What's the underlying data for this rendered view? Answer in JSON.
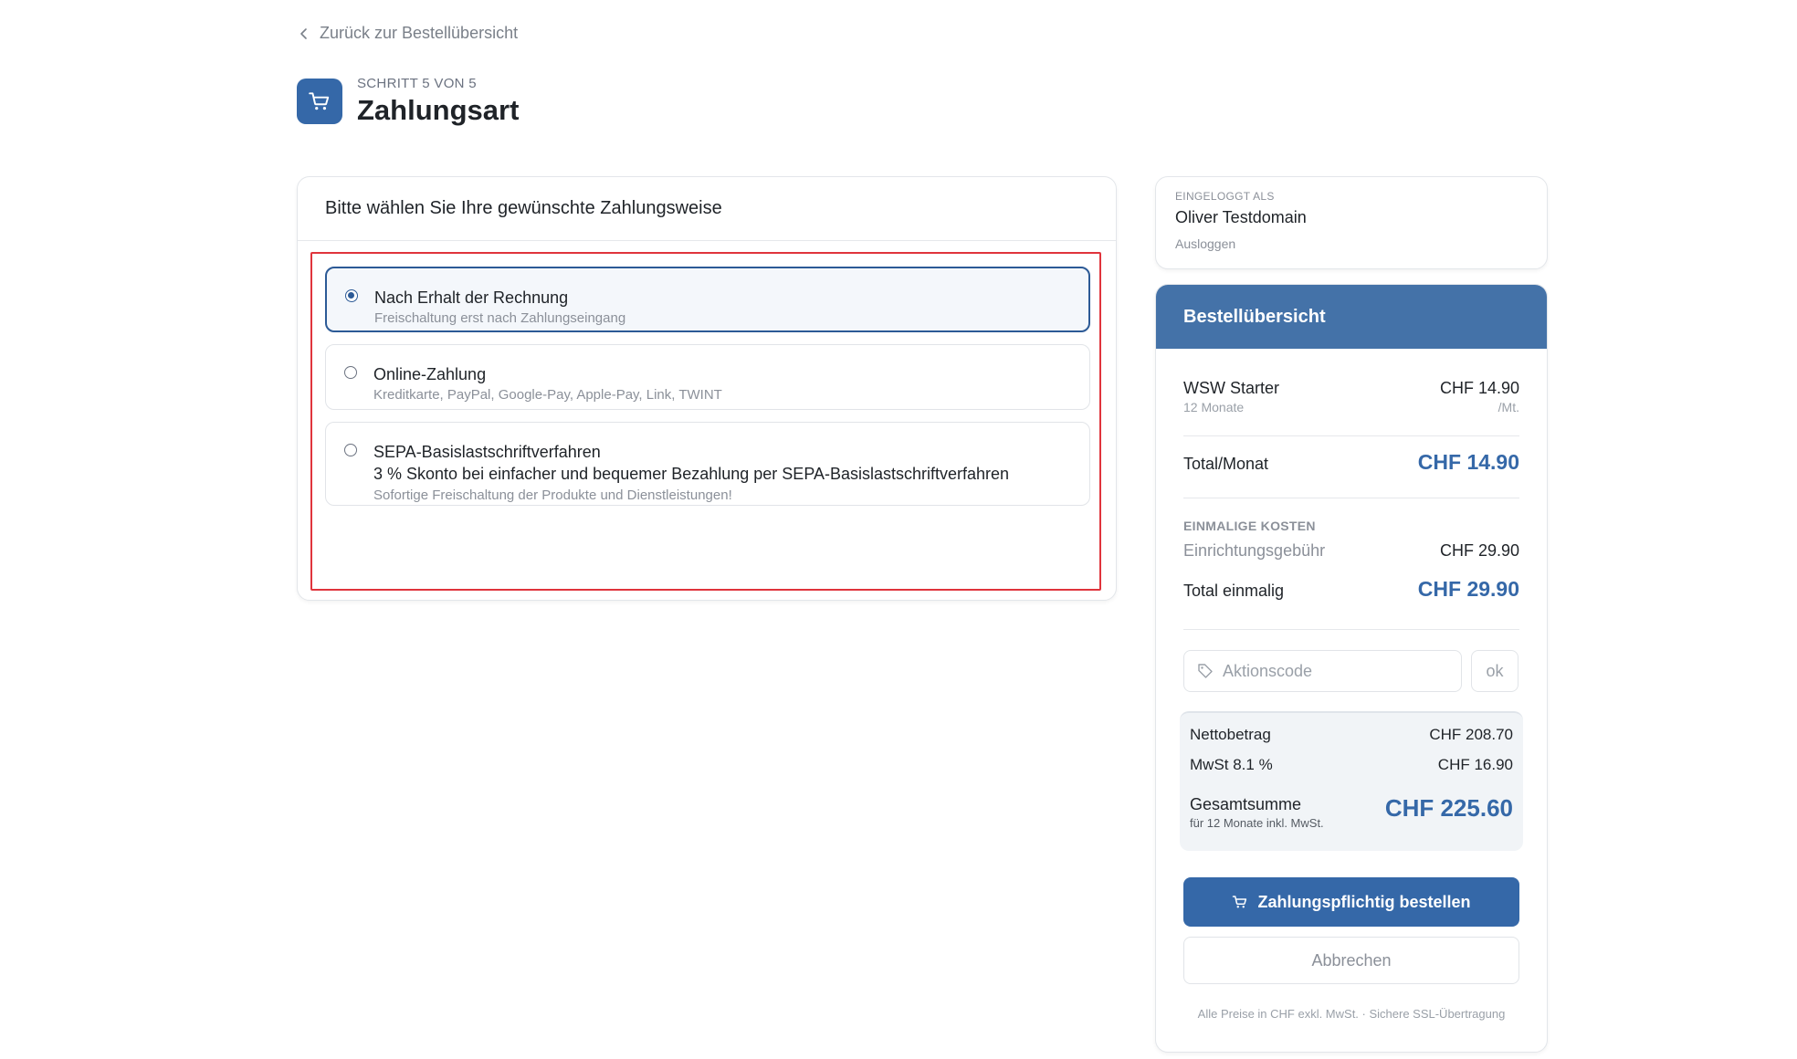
{
  "nav": {
    "back_label": "Zurück zur Bestellübersicht"
  },
  "header": {
    "step": "SCHRITT 5 VON 5",
    "title": "Zahlungsart"
  },
  "payment": {
    "heading": "Bitte wählen Sie Ihre gewünschte Zahlungsweise",
    "options": [
      {
        "title": "Nach Erhalt der Rechnung",
        "subtitle": "Freischaltung erst nach Zahlungseingang",
        "selected": true
      },
      {
        "title": "Online-Zahlung",
        "subtitle": "Kreditkarte, PayPal, Google-Pay, Apple-Pay, Link, TWINT",
        "selected": false
      },
      {
        "title": "SEPA-Basislastschriftverfahren",
        "line2": "3 % Skonto bei einfacher und bequemer Bezahlung per SEPA-Basislastschriftverfahren",
        "subtitle": "Sofortige Freischaltung der Produkte und Dienstleistungen!",
        "selected": false
      }
    ]
  },
  "account": {
    "label": "EINGELOGGT ALS",
    "name": "Oliver Testdomain",
    "logout": "Ausloggen"
  },
  "summary": {
    "title": "Bestellübersicht",
    "product": {
      "name": "WSW Starter",
      "term": "12 Monate",
      "price": "CHF 14.90",
      "unit": "/Mt."
    },
    "monthly": {
      "label": "Total/Monat",
      "value": "CHF 14.90"
    },
    "one_time": {
      "heading": "EINMALIGE KOSTEN",
      "setup_label": "Einrichtungsgebühr",
      "setup_value": "CHF 29.90",
      "total_label": "Total einmalig",
      "total_value": "CHF 29.90"
    },
    "promo": {
      "placeholder": "Aktionscode",
      "button": "ok"
    },
    "totals": {
      "net_label": "Nettobetrag",
      "net_value": "CHF 208.70",
      "vat_label": "MwSt 8.1 %",
      "vat_value": "CHF 16.90",
      "grand_label": "Gesamtsumme",
      "grand_note": "für 12 Monate inkl. MwSt.",
      "grand_value": "CHF 225.60"
    },
    "order_button": "Zahlungspflichtig bestellen",
    "cancel_button": "Abbrechen",
    "footnote": "Alle Preise in CHF exkl. MwSt. · Sichere SSL-Übertragung"
  },
  "colors": {
    "accent": "#3568a8",
    "header_bg": "#4472a8",
    "highlight": "#e0343c"
  },
  "icons": [
    "chevron-left-icon",
    "cart-icon",
    "tag-icon"
  ]
}
